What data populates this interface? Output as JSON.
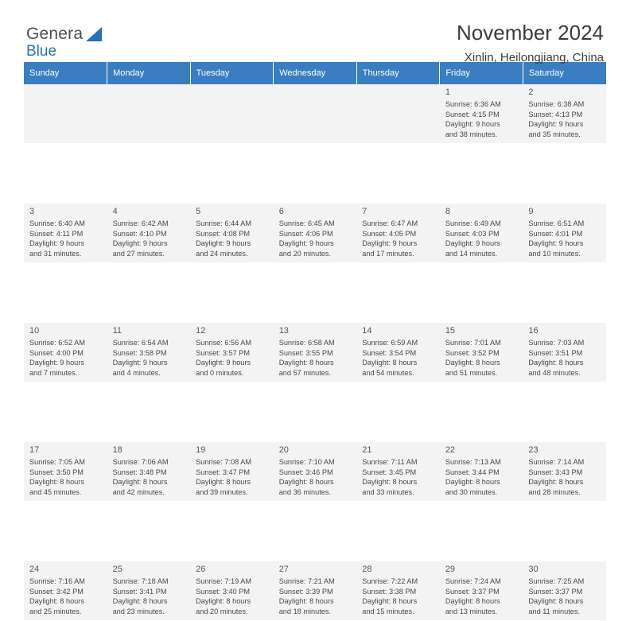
{
  "logo": {
    "word1": "General",
    "word2": "Blue",
    "flag_icon": "blue-flag-icon"
  },
  "header": {
    "title": "November 2024",
    "subtitle": "Xinlin, Heilongjiang, China"
  },
  "colors": {
    "header_row": "#3a7dc0",
    "cell_bg": "#f3f3f3",
    "brand_blue": "#2670b8"
  },
  "calendar": {
    "weekdays": [
      "Sunday",
      "Monday",
      "Tuesday",
      "Wednesday",
      "Thursday",
      "Friday",
      "Saturday"
    ],
    "weeks": [
      [
        {
          "day": "",
          "lines": []
        },
        {
          "day": "",
          "lines": []
        },
        {
          "day": "",
          "lines": []
        },
        {
          "day": "",
          "lines": []
        },
        {
          "day": "",
          "lines": []
        },
        {
          "day": "1",
          "lines": [
            "Sunrise: 6:36 AM",
            "Sunset: 4:15 PM",
            "Daylight: 9 hours",
            "and 38 minutes."
          ]
        },
        {
          "day": "2",
          "lines": [
            "Sunrise: 6:38 AM",
            "Sunset: 4:13 PM",
            "Daylight: 9 hours",
            "and 35 minutes."
          ]
        }
      ],
      [
        {
          "day": "3",
          "lines": [
            "Sunrise: 6:40 AM",
            "Sunset: 4:11 PM",
            "Daylight: 9 hours",
            "and 31 minutes."
          ]
        },
        {
          "day": "4",
          "lines": [
            "Sunrise: 6:42 AM",
            "Sunset: 4:10 PM",
            "Daylight: 9 hours",
            "and 27 minutes."
          ]
        },
        {
          "day": "5",
          "lines": [
            "Sunrise: 6:44 AM",
            "Sunset: 4:08 PM",
            "Daylight: 9 hours",
            "and 24 minutes."
          ]
        },
        {
          "day": "6",
          "lines": [
            "Sunrise: 6:45 AM",
            "Sunset: 4:06 PM",
            "Daylight: 9 hours",
            "and 20 minutes."
          ]
        },
        {
          "day": "7",
          "lines": [
            "Sunrise: 6:47 AM",
            "Sunset: 4:05 PM",
            "Daylight: 9 hours",
            "and 17 minutes."
          ]
        },
        {
          "day": "8",
          "lines": [
            "Sunrise: 6:49 AM",
            "Sunset: 4:03 PM",
            "Daylight: 9 hours",
            "and 14 minutes."
          ]
        },
        {
          "day": "9",
          "lines": [
            "Sunrise: 6:51 AM",
            "Sunset: 4:01 PM",
            "Daylight: 9 hours",
            "and 10 minutes."
          ]
        }
      ],
      [
        {
          "day": "10",
          "lines": [
            "Sunrise: 6:52 AM",
            "Sunset: 4:00 PM",
            "Daylight: 9 hours",
            "and 7 minutes."
          ]
        },
        {
          "day": "11",
          "lines": [
            "Sunrise: 6:54 AM",
            "Sunset: 3:58 PM",
            "Daylight: 9 hours",
            "and 4 minutes."
          ]
        },
        {
          "day": "12",
          "lines": [
            "Sunrise: 6:56 AM",
            "Sunset: 3:57 PM",
            "Daylight: 9 hours",
            "and 0 minutes."
          ]
        },
        {
          "day": "13",
          "lines": [
            "Sunrise: 6:58 AM",
            "Sunset: 3:55 PM",
            "Daylight: 8 hours",
            "and 57 minutes."
          ]
        },
        {
          "day": "14",
          "lines": [
            "Sunrise: 6:59 AM",
            "Sunset: 3:54 PM",
            "Daylight: 8 hours",
            "and 54 minutes."
          ]
        },
        {
          "day": "15",
          "lines": [
            "Sunrise: 7:01 AM",
            "Sunset: 3:52 PM",
            "Daylight: 8 hours",
            "and 51 minutes."
          ]
        },
        {
          "day": "16",
          "lines": [
            "Sunrise: 7:03 AM",
            "Sunset: 3:51 PM",
            "Daylight: 8 hours",
            "and 48 minutes."
          ]
        }
      ],
      [
        {
          "day": "17",
          "lines": [
            "Sunrise: 7:05 AM",
            "Sunset: 3:50 PM",
            "Daylight: 8 hours",
            "and 45 minutes."
          ]
        },
        {
          "day": "18",
          "lines": [
            "Sunrise: 7:06 AM",
            "Sunset: 3:48 PM",
            "Daylight: 8 hours",
            "and 42 minutes."
          ]
        },
        {
          "day": "19",
          "lines": [
            "Sunrise: 7:08 AM",
            "Sunset: 3:47 PM",
            "Daylight: 8 hours",
            "and 39 minutes."
          ]
        },
        {
          "day": "20",
          "lines": [
            "Sunrise: 7:10 AM",
            "Sunset: 3:46 PM",
            "Daylight: 8 hours",
            "and 36 minutes."
          ]
        },
        {
          "day": "21",
          "lines": [
            "Sunrise: 7:11 AM",
            "Sunset: 3:45 PM",
            "Daylight: 8 hours",
            "and 33 minutes."
          ]
        },
        {
          "day": "22",
          "lines": [
            "Sunrise: 7:13 AM",
            "Sunset: 3:44 PM",
            "Daylight: 8 hours",
            "and 30 minutes."
          ]
        },
        {
          "day": "23",
          "lines": [
            "Sunrise: 7:14 AM",
            "Sunset: 3:43 PM",
            "Daylight: 8 hours",
            "and 28 minutes."
          ]
        }
      ],
      [
        {
          "day": "24",
          "lines": [
            "Sunrise: 7:16 AM",
            "Sunset: 3:42 PM",
            "Daylight: 8 hours",
            "and 25 minutes."
          ]
        },
        {
          "day": "25",
          "lines": [
            "Sunrise: 7:18 AM",
            "Sunset: 3:41 PM",
            "Daylight: 8 hours",
            "and 23 minutes."
          ]
        },
        {
          "day": "26",
          "lines": [
            "Sunrise: 7:19 AM",
            "Sunset: 3:40 PM",
            "Daylight: 8 hours",
            "and 20 minutes."
          ]
        },
        {
          "day": "27",
          "lines": [
            "Sunrise: 7:21 AM",
            "Sunset: 3:39 PM",
            "Daylight: 8 hours",
            "and 18 minutes."
          ]
        },
        {
          "day": "28",
          "lines": [
            "Sunrise: 7:22 AM",
            "Sunset: 3:38 PM",
            "Daylight: 8 hours",
            "and 15 minutes."
          ]
        },
        {
          "day": "29",
          "lines": [
            "Sunrise: 7:24 AM",
            "Sunset: 3:37 PM",
            "Daylight: 8 hours",
            "and 13 minutes."
          ]
        },
        {
          "day": "30",
          "lines": [
            "Sunrise: 7:25 AM",
            "Sunset: 3:37 PM",
            "Daylight: 8 hours",
            "and 11 minutes."
          ]
        }
      ]
    ]
  }
}
